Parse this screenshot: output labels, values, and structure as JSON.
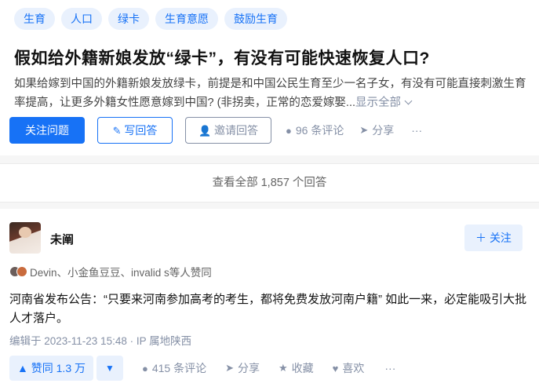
{
  "question": {
    "tags": [
      "生育",
      "人口",
      "绿卡",
      "生育意愿",
      "鼓励生育"
    ],
    "title": "假如给外籍新娘发放“绿卡”，有没有可能快速恢复人口?",
    "description": "如果给嫁到中国的外籍新娘发放绿卡，前提是和中国公民生育至少一名子女，有没有可能直接刺激生育率提高，让更多外籍女性愿意嫁到中国? (非拐卖，正常的恋爱嫁娶...",
    "show_all": "显示全部",
    "actions": {
      "follow": "关注问题",
      "write": "写回答",
      "invite": "邀请回答",
      "comments": "96 条评论",
      "share": "分享",
      "more": "···"
    }
  },
  "view_all": "查看全部 1,857 个回答",
  "answer": {
    "author": "未阐",
    "follow": "关注",
    "voters": "Devin、小金鱼豆豆、invalid s等人赞同",
    "content": "河南省发布公告：“只要来河南参加高考的考生，都将免费发放河南户籍” 如此一来，必定能吸引大批人才落户。",
    "edited": "编辑于 2023-11-23 15:48 · IP 属地陕西",
    "upvote": "赞同 1.3 万",
    "comments": "415 条评论",
    "share": "分享",
    "collect": "收藏",
    "like": "喜欢",
    "more": "···"
  },
  "colors": {
    "accent": "#1772f6",
    "meta": "#8590a6",
    "tag_bg": "#e9f1fd"
  }
}
